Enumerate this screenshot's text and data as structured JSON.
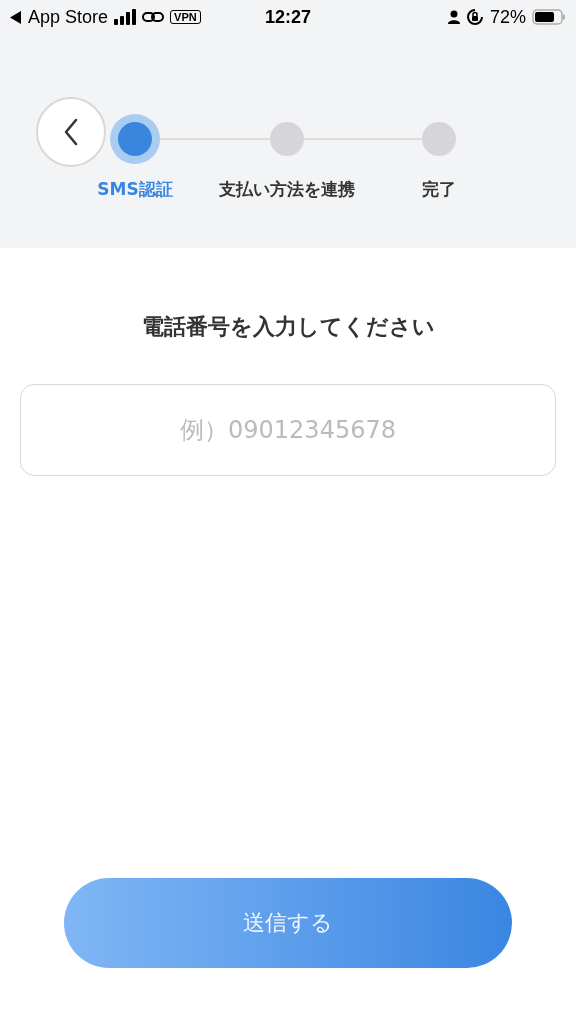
{
  "status_bar": {
    "back_app": "App Store",
    "vpn": "VPN",
    "time": "12:27",
    "battery": "72%"
  },
  "steps": [
    {
      "label": "SMS認証",
      "selected": true
    },
    {
      "label": "支払い方法を連携",
      "selected": false
    },
    {
      "label": "完了",
      "selected": false
    }
  ],
  "title": "電話番号を入力してください",
  "phone_field": {
    "placeholder": "例）09012345678"
  },
  "submit_button": "送信する"
}
